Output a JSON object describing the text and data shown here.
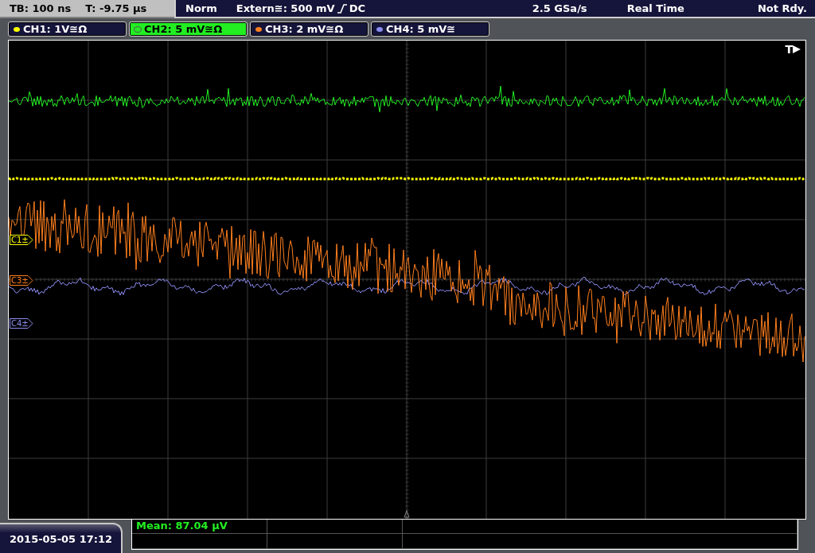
{
  "status_bar": {
    "timebase": "TB: 100 ns",
    "trigger_time": "T: -9.75 µs",
    "mode": "Norm",
    "trigger_source": "Extern≅: 500 mV",
    "trigger_coupling": "DC",
    "sample_rate": "2.5 GSa/s",
    "acquisition": "Real Time",
    "state": "Not Rdy."
  },
  "channels": [
    {
      "label": "CH1: 1V≅Ω",
      "color": "#ffff00",
      "selected": false,
      "marker": "C1±"
    },
    {
      "label": "CH2: 5 mV≅Ω",
      "color": "#22ee22",
      "selected": true
    },
    {
      "label": "CH3: 2 mV≅Ω",
      "color": "#ff7f1e",
      "selected": false,
      "marker": "C3±"
    },
    {
      "label": "CH4: 5 mV≅",
      "color": "#8c8cf0",
      "selected": false,
      "marker": "C4±"
    }
  ],
  "screen": {
    "trigger_label": "T"
  },
  "measurements": [
    "Mean: 87.04 µV"
  ],
  "timestamp": "2015-05-05 17:12"
}
